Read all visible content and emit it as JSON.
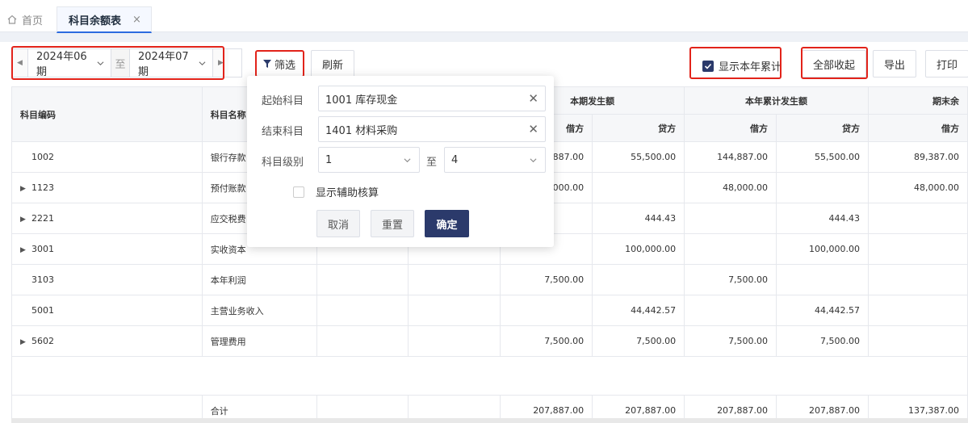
{
  "tabs": {
    "home": "首页",
    "active": "科目余额表",
    "close": "×"
  },
  "toolbar": {
    "start_period": "2024年06期",
    "to": "至",
    "end_period": "2024年07期",
    "filter": "筛选",
    "refresh": "刷新",
    "show_ytd": "显示本年累计",
    "show_ytd_checked": true,
    "collapse_all": "全部收起",
    "export": "导出",
    "print": "打印"
  },
  "table": {
    "headers": {
      "code": "科目编码",
      "name": "科目名称",
      "current": "本期发生额",
      "ytd": "本年累计发生额",
      "ending": "期末余",
      "debit": "借方",
      "credit": "贷方"
    },
    "rows": [
      {
        "code": "1002",
        "expandable": false,
        "name": "银行存款",
        "cur_debit": "887.00",
        "cur_credit": "55,500.00",
        "ytd_debit": "144,887.00",
        "ytd_credit": "55,500.00",
        "end_debit": "89,387.00"
      },
      {
        "code": "1123",
        "expandable": true,
        "name": "预付账款",
        "cur_debit": ",000.00",
        "cur_credit": "",
        "ytd_debit": "48,000.00",
        "ytd_credit": "",
        "end_debit": "48,000.00"
      },
      {
        "code": "2221",
        "expandable": true,
        "name": "应交税费",
        "cur_debit": "",
        "cur_credit": "444.43",
        "ytd_debit": "",
        "ytd_credit": "444.43",
        "end_debit": ""
      },
      {
        "code": "3001",
        "expandable": true,
        "name": "实收资本",
        "cur_debit": "",
        "cur_credit": "100,000.00",
        "ytd_debit": "",
        "ytd_credit": "100,000.00",
        "end_debit": ""
      },
      {
        "code": "3103",
        "expandable": false,
        "name": "本年利润",
        "cur_debit": "7,500.00",
        "cur_credit": "",
        "ytd_debit": "7,500.00",
        "ytd_credit": "",
        "end_debit": ""
      },
      {
        "code": "5001",
        "expandable": false,
        "name": "主营业务收入",
        "cur_debit": "",
        "cur_credit": "44,442.57",
        "ytd_debit": "",
        "ytd_credit": "44,442.57",
        "end_debit": ""
      },
      {
        "code": "5602",
        "expandable": true,
        "name": "管理费用",
        "cur_debit": "7,500.00",
        "cur_credit": "7,500.00",
        "ytd_debit": "7,500.00",
        "ytd_credit": "7,500.00",
        "end_debit": ""
      }
    ],
    "total": {
      "label": "合计",
      "cur_debit": "207,887.00",
      "cur_credit": "207,887.00",
      "ytd_debit": "207,887.00",
      "ytd_credit": "207,887.00",
      "end_debit": "137,387.00"
    }
  },
  "filter_popover": {
    "start_label": "起始科目",
    "start_value": "1001 库存现金",
    "end_label": "结束科目",
    "end_value": "1401 材料采购",
    "level_label": "科目级别",
    "level_from": "1",
    "level_to_label": "至",
    "level_to": "4",
    "show_aux": "显示辅助核算",
    "cancel": "取消",
    "reset": "重置",
    "confirm": "确定"
  },
  "colors": {
    "primary": "#2b3a6b",
    "highlight": "#e2231a"
  }
}
